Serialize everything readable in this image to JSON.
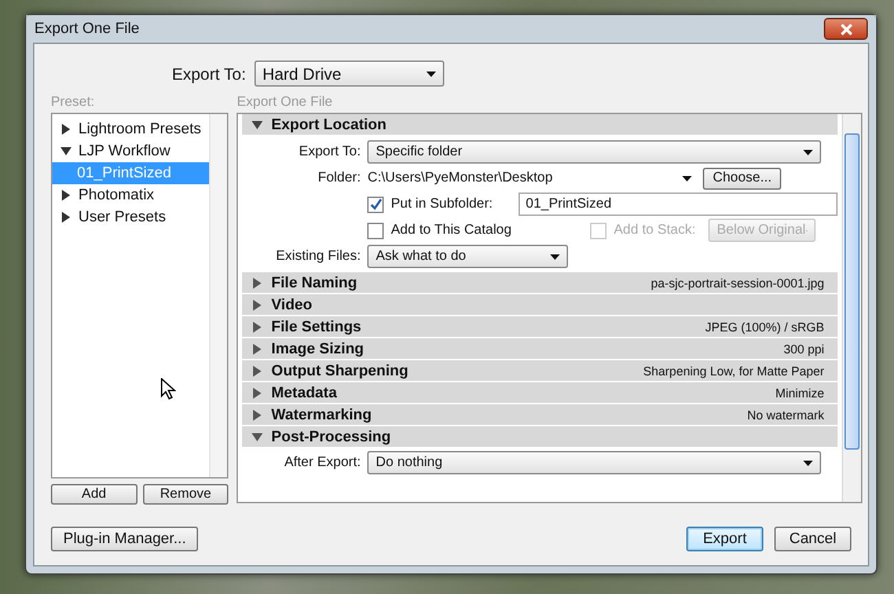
{
  "window": {
    "title": "Export One File"
  },
  "export_to": {
    "label": "Export To:",
    "value": "Hard Drive"
  },
  "preset": {
    "label": "Preset:",
    "items": [
      {
        "label": "Lightroom Presets",
        "expanded": false,
        "selected": false
      },
      {
        "label": "LJP Workflow",
        "expanded": true,
        "selected": false,
        "children": [
          {
            "label": "01_PrintSized",
            "selected": true
          }
        ]
      },
      {
        "label": "Photomatix",
        "expanded": false,
        "selected": false
      },
      {
        "label": "User Presets",
        "expanded": false,
        "selected": false
      }
    ],
    "buttons": [
      "Add",
      "Remove"
    ]
  },
  "export_panel": {
    "label": "Export One File",
    "location": {
      "title": "Export Location",
      "expanded": true,
      "export_to": {
        "label": "Export To:",
        "value": "Specific folder"
      },
      "folder": {
        "label": "Folder:",
        "value": "C:\\Users\\PyeMonster\\Desktop",
        "button": "Choose..."
      },
      "subfolder": {
        "label": "Put in Subfolder:",
        "checked": true,
        "value": "01_PrintSized"
      },
      "add_to_catalog": {
        "label": "Add to This Catalog",
        "checked": false
      },
      "add_to_stack": {
        "label": "Add to Stack:",
        "checked": false,
        "disabled": true,
        "value": "Below Original"
      },
      "existing_files": {
        "label": "Existing Files:",
        "value": "Ask what to do"
      }
    },
    "sections": [
      {
        "title": "File Naming",
        "summary": "pa-sjc-portrait-session-0001.jpg",
        "expanded": false
      },
      {
        "title": "Video",
        "expanded": false
      },
      {
        "title": "File Settings",
        "summary": "JPEG (100%) / sRGB",
        "expanded": false
      },
      {
        "title": "Image Sizing",
        "summary": "300 ppi",
        "expanded": false
      },
      {
        "title": "Output Sharpening",
        "summary": "Sharpening Low, for Matte Paper",
        "expanded": false
      },
      {
        "title": "Metadata",
        "summary": "Minimize",
        "expanded": false
      },
      {
        "title": "Watermarking",
        "summary": "No watermark",
        "expanded": false
      },
      {
        "title": "Post-Processing",
        "expanded": true,
        "field": {
          "label": "After Export:",
          "value": "Do nothing"
        }
      }
    ]
  },
  "footer": {
    "left_button": "Plug-in Manager...",
    "buttons": [
      {
        "label": "Export",
        "default": true
      },
      {
        "label": "Cancel",
        "default": false
      }
    ]
  }
}
